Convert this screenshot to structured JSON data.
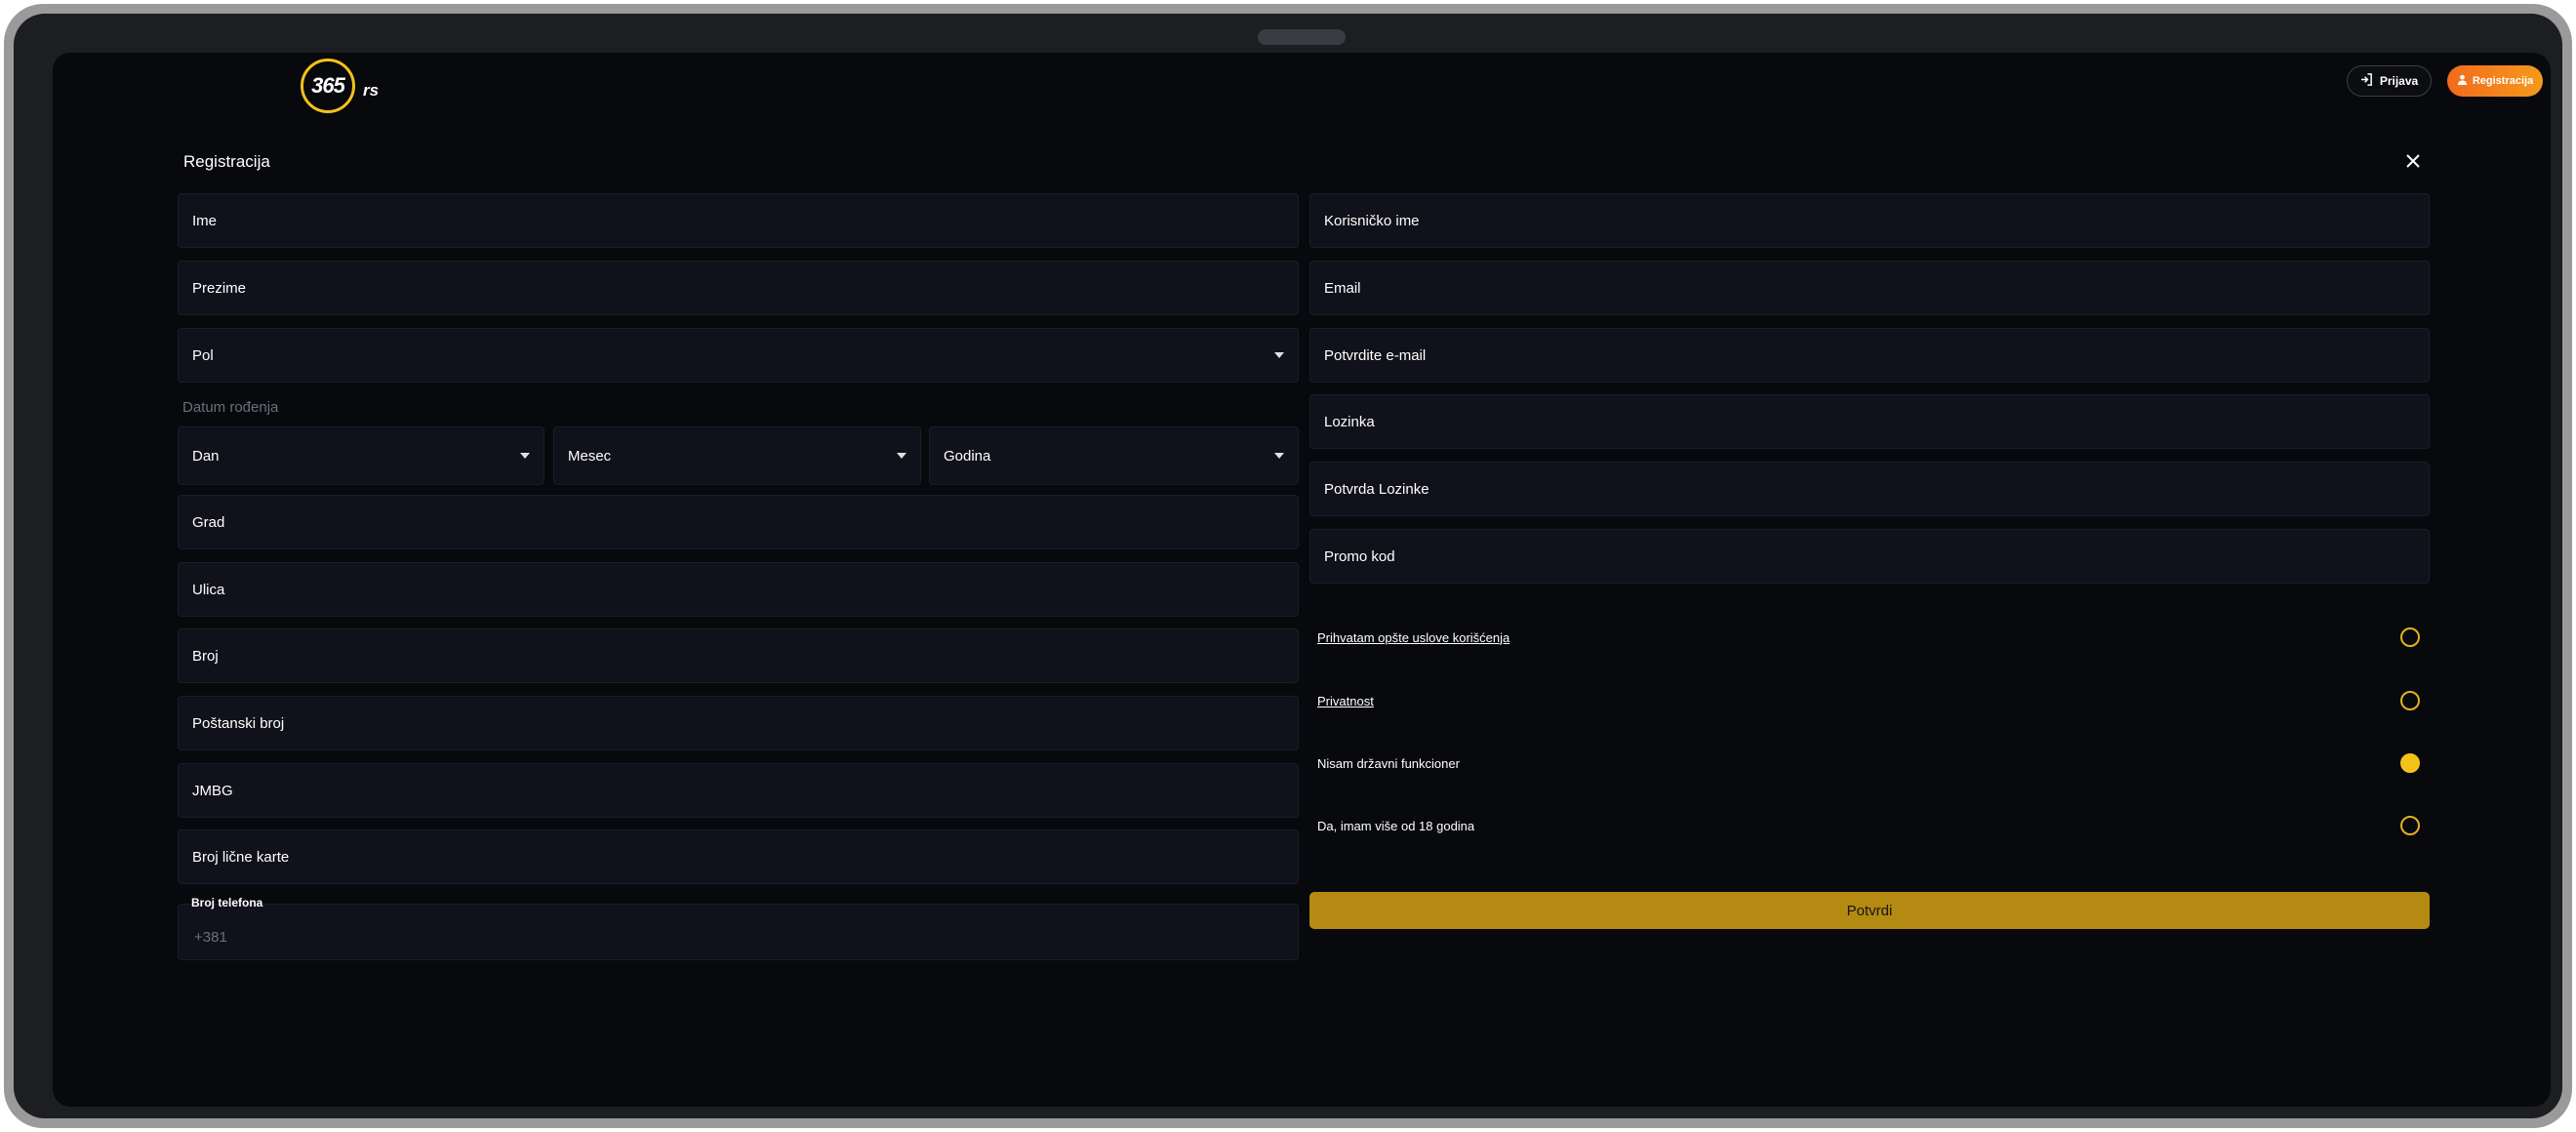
{
  "header": {
    "logo_number": "365",
    "logo_suffix": "rs",
    "login_label": "Prijava",
    "register_label": "Registracija"
  },
  "form": {
    "title": "Registracija",
    "left_fields": {
      "first_name": "Ime",
      "last_name": "Prezime",
      "gender": "Pol",
      "dob_label": "Datum rođenja",
      "day": "Dan",
      "month": "Mesec",
      "year": "Godina",
      "city": "Grad",
      "street": "Ulica",
      "number": "Broj",
      "postal_code": "Poštanski broj",
      "jmbg": "JMBG",
      "id_card": "Broj lične karte",
      "phone_label": "Broj telefona",
      "phone_placeholder": "+381"
    },
    "right_fields": {
      "username": "Korisničko ime",
      "email": "Email",
      "confirm_email": "Potvrdite e-mail",
      "password": "Lozinka",
      "confirm_password": "Potvrda Lozinke",
      "promo_code": "Promo kod"
    },
    "checks": [
      {
        "label": "Prihvatam opšte uslove korišćenja",
        "checked": false,
        "link": true
      },
      {
        "label": "Privatnost",
        "checked": false,
        "link": true
      },
      {
        "label": "Nisam državni funkcioner",
        "checked": true,
        "link": false
      },
      {
        "label": "Da, imam više od 18 godina",
        "checked": false,
        "link": false
      }
    ],
    "submit_label": "Potvrdi"
  },
  "colors": {
    "background": "#08090d",
    "field_bg": "#10111a",
    "accent_yellow": "#f2c21b",
    "submit_bg": "#b48a12",
    "register_orange": "#f26a1c"
  },
  "icons": {
    "login": "login-arrow-icon",
    "register": "user-icon",
    "close": "close-icon",
    "dropdown": "caret-down-icon"
  }
}
